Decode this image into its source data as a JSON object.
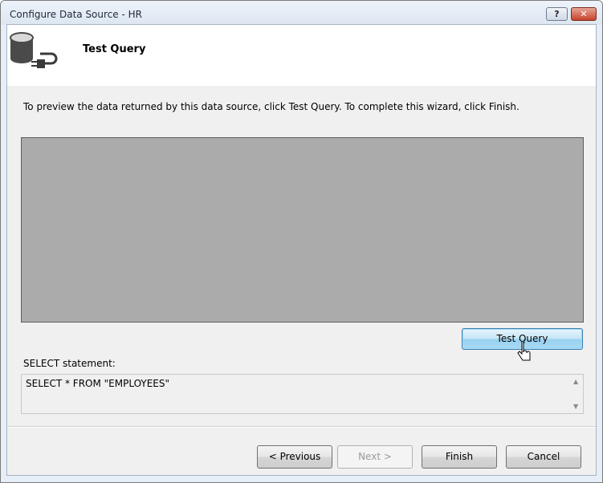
{
  "window": {
    "title": "Configure Data Source - HR"
  },
  "titlebar": {
    "help_label": "?",
    "close_label": "✕"
  },
  "header": {
    "title": "Test Query"
  },
  "instruction": "To preview the data returned by this data source, click Test Query. To complete this wizard, click Finish.",
  "test_query": {
    "label": "Test Query"
  },
  "select": {
    "label": "SELECT statement:",
    "value": "SELECT * FROM \"EMPLOYEES\""
  },
  "scroll": {
    "up": "▲",
    "down": "▼"
  },
  "buttons": {
    "previous": "< Previous",
    "next": "Next >",
    "finish": "Finish",
    "cancel": "Cancel"
  }
}
